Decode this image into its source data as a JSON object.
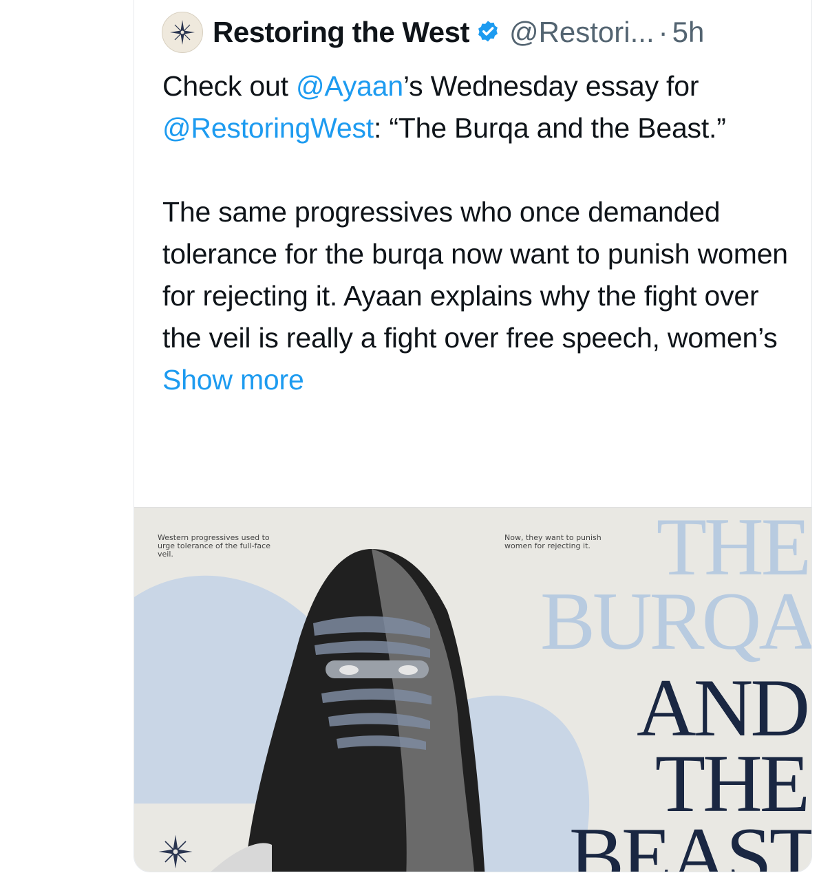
{
  "tweet": {
    "author_name": "Restoring the West",
    "author_handle": "@Restori...",
    "separator": "·",
    "time": "5h",
    "text": {
      "p1_part1": "Check out ",
      "p1_mention1": "@Ayaan",
      "p1_part2": "’s Wednesday essay for ",
      "p1_mention2": "@RestoringWest",
      "p1_part3": ": “The Burqa and the Beast.”",
      "p2": "The same progressives who once demanded tolerance for the burqa now want to punish women for rejecting it. Ayaan explains why the fight over the veil is really a fight over free speech, women’s ",
      "show_more": "Show more"
    }
  },
  "media": {
    "caption_left": "Western progressives used to urge tolerance of the full-face veil.",
    "caption_right": "Now, they want to punish women for rejecting it.",
    "title_lines": [
      "THE",
      "BURQA",
      "AND",
      "THE",
      "BEAST"
    ]
  },
  "icons": {
    "avatar": "compass-star-icon",
    "verified": "verified-badge-icon",
    "logo": "compass-star-icon"
  },
  "colors": {
    "mention": "#1d9bf0",
    "verified": "#1d9bf0",
    "title_light": "#b8cbe0",
    "title_dark": "#1a2742"
  }
}
